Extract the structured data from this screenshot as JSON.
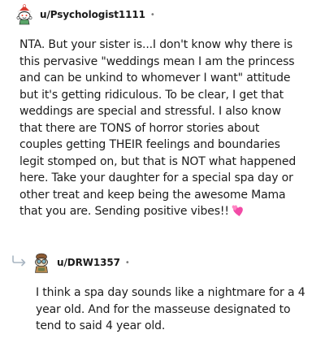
{
  "comments": [
    {
      "username": "u/Psychologist1111",
      "separator": "•",
      "avatar_icon": "snoo-avatar-red-hat-icon",
      "body": "NTA. But your sister is...I don't know why there is this pervasive \"weddings mean I am the princess and can be unkind to whomever I want\" attitude but it's getting ridiculous. To be clear, I get that weddings are special and stressful. I also know that there are TONS of horror stories about couples getting THEIR feelings and boundaries legit stomped on, but that is NOT what happened here. Take your daughter for a special spa day or other treat and keep being the awesome Mama that you are. Sending positive vibes!!",
      "emoji_icon": "two-hearts-emoji-icon"
    },
    {
      "username": "u/DRW1357",
      "separator": "•",
      "avatar_icon": "snoo-avatar-goggles-icon",
      "reply_icon": "reply-arrow-icon",
      "body": "I think a spa day sounds like a nightmare for a 4 year old. And for the masseuse designated to tend to said 4 year old."
    }
  ],
  "colors": {
    "text": "#1c1c1c",
    "muted": "#7c7c7c",
    "heart": "#f24aa6"
  }
}
